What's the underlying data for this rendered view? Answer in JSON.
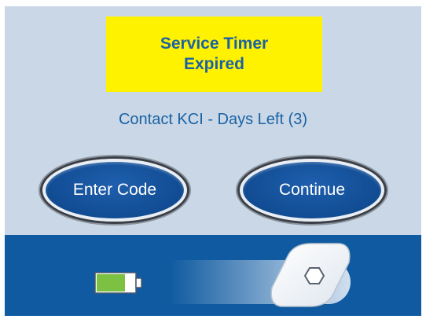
{
  "alert": {
    "line1": "Service Timer",
    "line2": "Expired"
  },
  "message": "Contact KCI - Days Left (3)",
  "buttons": {
    "enter_code": "Enter Code",
    "continue": "Continue"
  },
  "battery": {
    "level": 0.75,
    "fill_color": "#7dc142"
  },
  "colors": {
    "background": "#c9d7e7",
    "alert_bg": "#fff200",
    "text_blue": "#1b62a3",
    "button_blue": "#114c93",
    "bar_blue": "#0f5aa0"
  },
  "icons": {
    "battery": "battery-icon",
    "slider": "slide-unlock-icon"
  }
}
